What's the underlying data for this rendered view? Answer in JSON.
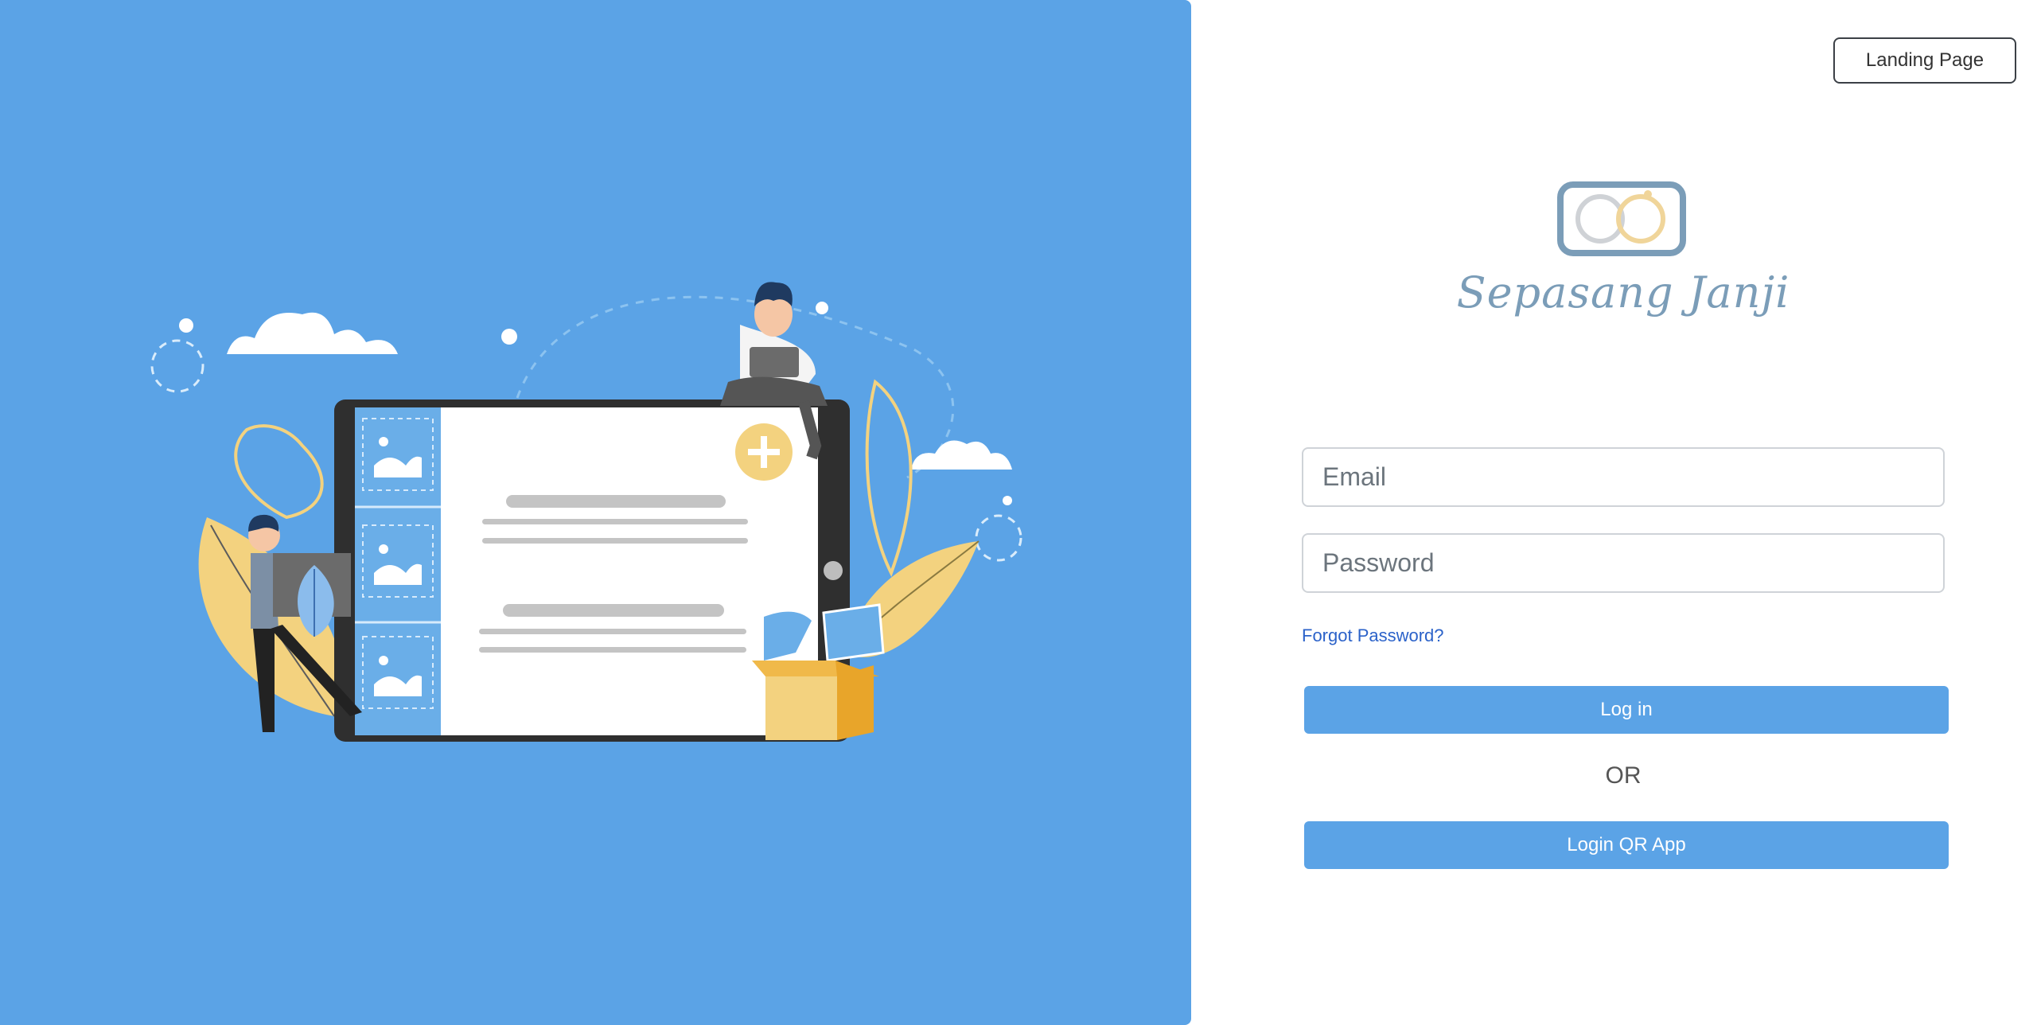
{
  "header": {
    "landing_label": "Landing Page"
  },
  "brand": {
    "name": "Sepasang Janji"
  },
  "form": {
    "email_placeholder": "Email",
    "password_placeholder": "Password",
    "forgot_label": "Forgot Password?",
    "login_label": "Log in",
    "or_label": "OR",
    "qr_label": "Login QR App"
  },
  "colors": {
    "panel": "#5ba3e6",
    "button": "#5ba3e6",
    "link": "#2b62c9",
    "accent_yellow": "#f3d27f",
    "logo_gray": "#7b9db8"
  },
  "illustration": {
    "icon": "tablet-upload-illustration"
  }
}
